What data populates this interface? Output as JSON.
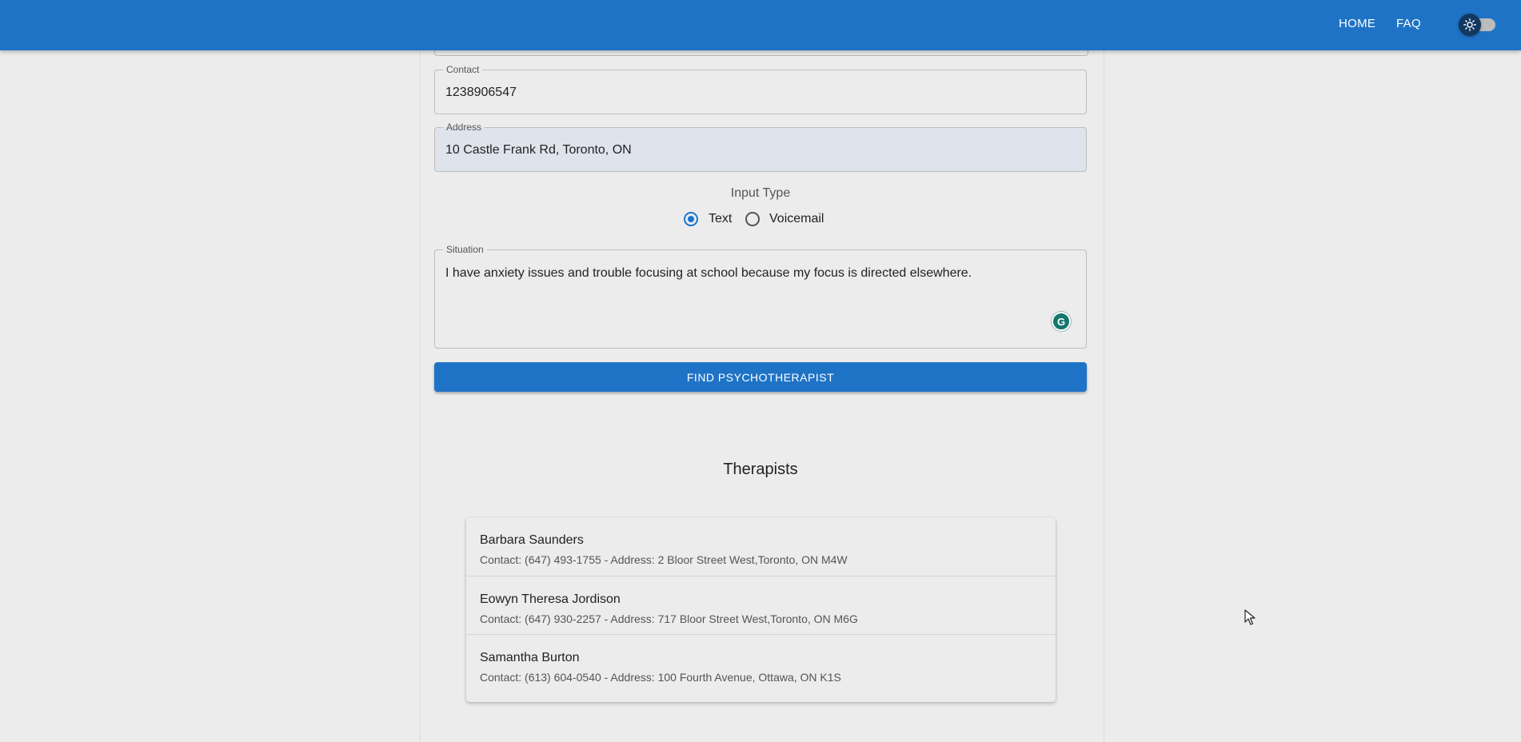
{
  "header": {
    "nav": [
      "HOME",
      "FAQ"
    ],
    "theme_toggle_icon": "sun-icon",
    "colors": {
      "bar": "#1f73c6",
      "toggle_thumb": "#12385f"
    }
  },
  "form": {
    "contact": {
      "label": "Contact",
      "value": "1238906547"
    },
    "address": {
      "label": "Address",
      "value": "10 Castle Frank Rd, Toronto, ON"
    },
    "input_type": {
      "title": "Input Type",
      "options": [
        "Text",
        "Voicemail"
      ],
      "selected": "Text"
    },
    "situation": {
      "label": "Situation",
      "value": "I have anxiety issues and trouble focusing at school because my focus is directed elsewhere."
    },
    "grammarly_icon": "grammarly-icon",
    "submit_label": "FIND PSYCHOTHERAPIST"
  },
  "therapists": {
    "title": "Therapists",
    "items": [
      {
        "name": "Barbara Saunders",
        "detail": "Contact: (647) 493-1755 - Address: 2 Bloor Street West,Toronto, ON M4W"
      },
      {
        "name": "Eowyn Theresa Jordison",
        "detail": "Contact: (647) 930-2257 - Address: 717 Bloor Street West,Toronto, ON M6G"
      },
      {
        "name": "Samantha Burton",
        "detail": "Contact: (613) 604-0540 - Address: 100 Fourth Avenue, Ottawa, ON K1S"
      }
    ]
  }
}
